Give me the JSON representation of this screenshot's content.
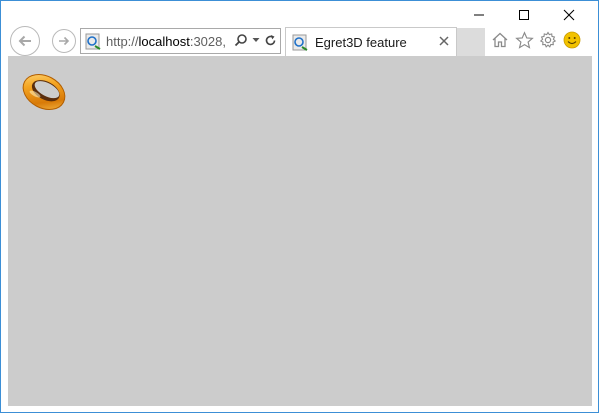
{
  "window": {
    "controls": {
      "minimize_icon": "minimize-icon",
      "maximize_icon": "maximize-icon",
      "close_icon": "close-icon"
    }
  },
  "navigation": {
    "back_icon": "back-arrow-icon",
    "forward_icon": "forward-arrow-icon"
  },
  "address_bar": {
    "url_scheme": "http://",
    "url_host": "localhost",
    "url_rest": ":3028,",
    "search_icon": "search-icon",
    "dropdown_icon": "chevron-down-icon",
    "refresh_icon": "refresh-icon"
  },
  "tab": {
    "title": "Egret3D feature",
    "close_symbol": "×"
  },
  "toolbar": {
    "home_icon": "home-icon",
    "favorites_icon": "star-icon",
    "settings_icon": "gear-icon",
    "feedback_icon": "smiley-icon"
  },
  "page": {
    "background_color": "#cccccc",
    "logo_icon": "ring-logo-icon"
  },
  "colors": {
    "window_border": "#3c8fd6",
    "accent_ie": "#1e70c8",
    "smiley": "#f2c200",
    "ring_gold": "#f0a020"
  }
}
